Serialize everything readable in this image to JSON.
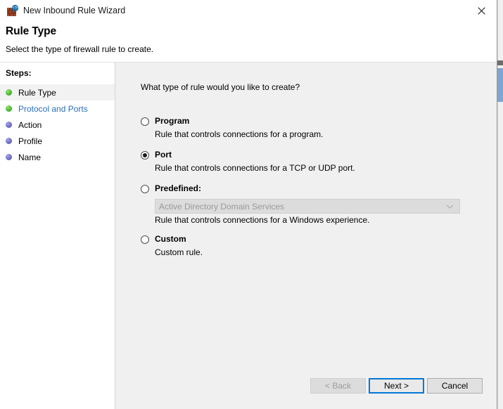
{
  "window": {
    "title": "New Inbound Rule Wizard",
    "icon": "firewall-icon",
    "close_label": "✕"
  },
  "header": {
    "title": "Rule Type",
    "subtitle": "Select the type of firewall rule to create."
  },
  "sidebar": {
    "heading": "Steps:",
    "items": [
      {
        "label": "Rule Type",
        "bullet": "green",
        "state": "current"
      },
      {
        "label": "Protocol and Ports",
        "bullet": "green",
        "state": "link"
      },
      {
        "label": "Action",
        "bullet": "purple",
        "state": "pending"
      },
      {
        "label": "Profile",
        "bullet": "purple",
        "state": "pending"
      },
      {
        "label": "Name",
        "bullet": "purple",
        "state": "pending"
      }
    ]
  },
  "main": {
    "question": "What type of rule would you like to create?",
    "options": [
      {
        "title": "Program",
        "description": "Rule that controls connections for a program.",
        "selected": false
      },
      {
        "title": "Port",
        "description": "Rule that controls connections for a TCP or UDP port.",
        "selected": true
      },
      {
        "title": "Predefined:",
        "description": "Rule that controls connections for a Windows experience.",
        "selected": false,
        "combo_value": "Active Directory Domain Services"
      },
      {
        "title": "Custom",
        "description": "Custom rule.",
        "selected": false
      }
    ]
  },
  "buttons": {
    "back": "< Back",
    "next": "Next >",
    "cancel": "Cancel"
  },
  "colors": {
    "accent": "#0078d7",
    "link": "#2a6fba",
    "panel": "#f0f0f0",
    "bullet_done": "#57c23a",
    "bullet_pending": "#7a78cf"
  }
}
